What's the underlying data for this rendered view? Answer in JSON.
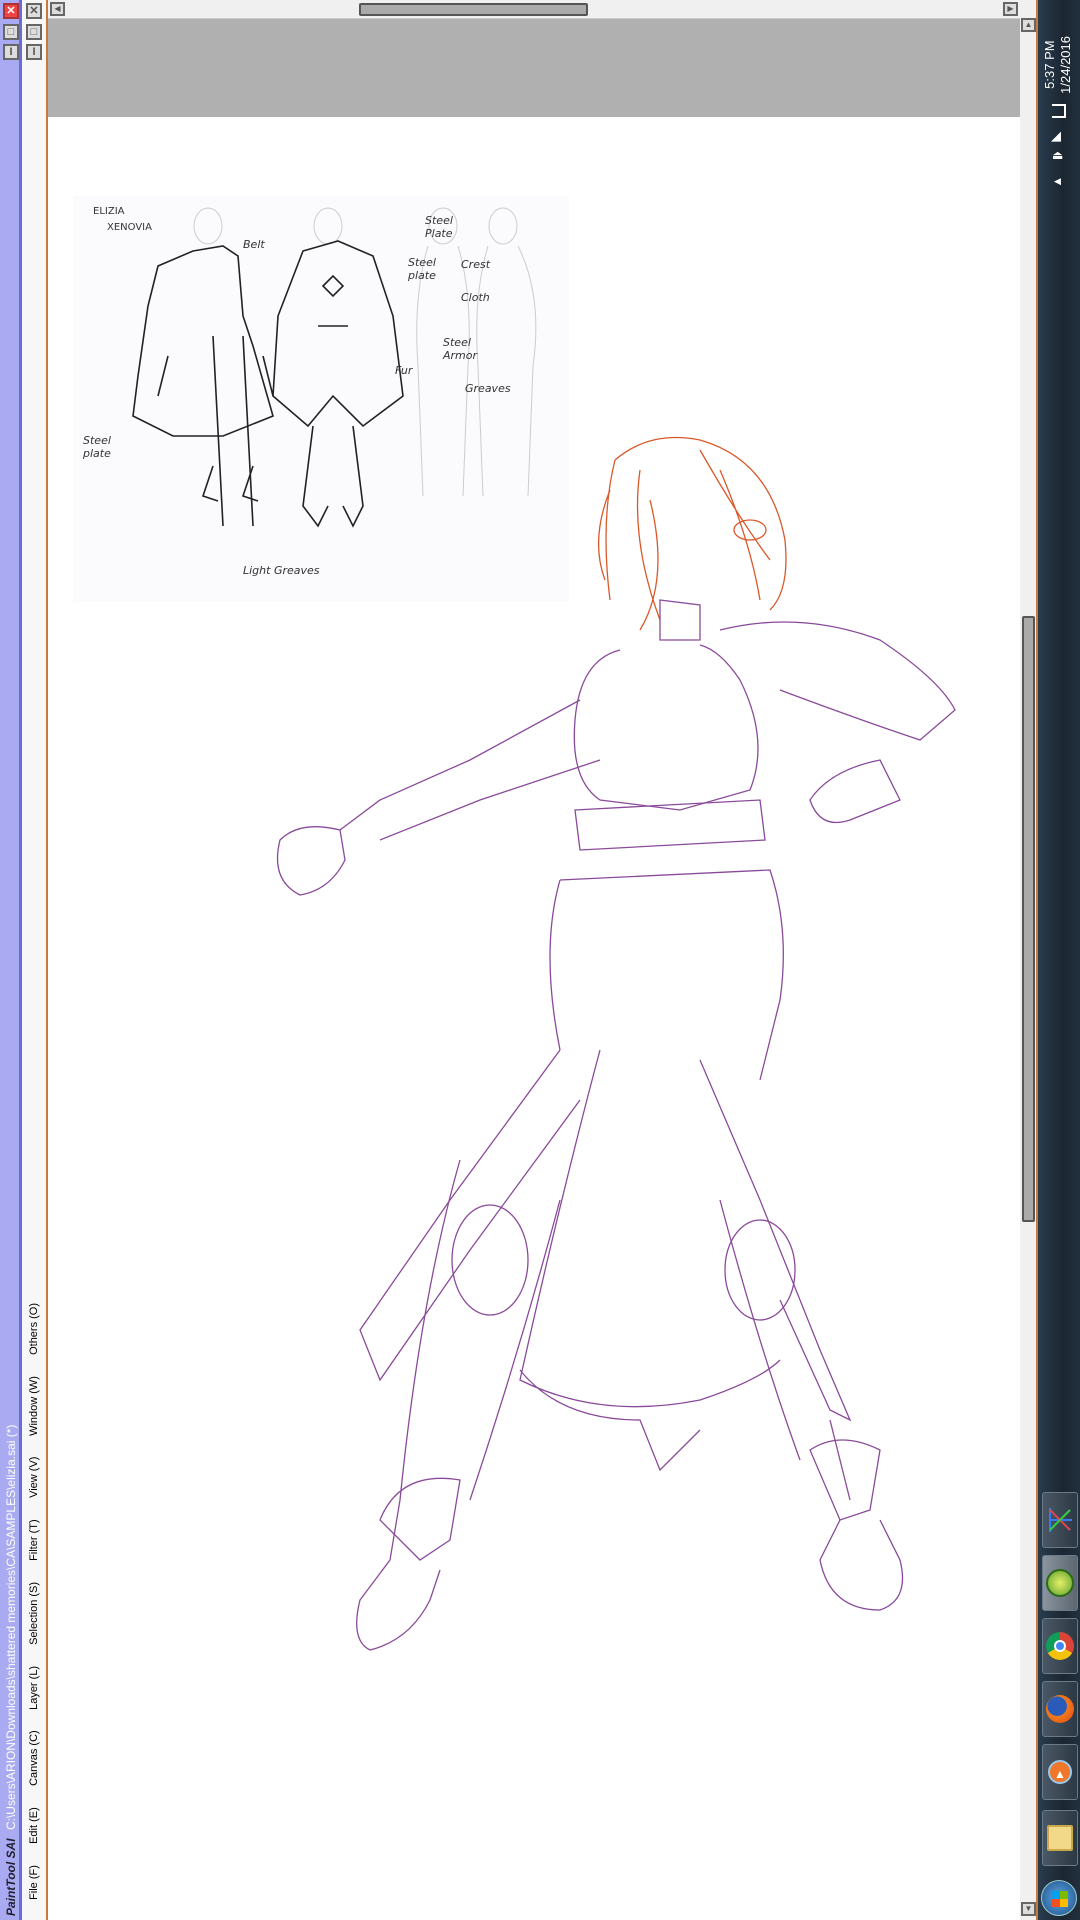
{
  "app": {
    "logo": "PaintTool SAI",
    "title": "C:\\Users\\ARION\\Downloads\\shattered memories\\CA\\SAMPLES\\elizia.sai (*)"
  },
  "menu": [
    "File (F)",
    "Edit (E)",
    "Canvas (C)",
    "Layer (L)",
    "Selection (S)",
    "Filter (T)",
    "View (V)",
    "Window (W)",
    "Others (O)"
  ],
  "sketch": {
    "name_line1": "ELIZIA",
    "name_line2": "XENOVIA",
    "labels": [
      "Belt",
      "Steel Plate",
      "Steel plate",
      "Crest",
      "Cloth",
      "Steel Armor",
      "Fur",
      "Greaves",
      "Steel plate",
      "Light Greaves"
    ]
  },
  "taskbar": {
    "time": "5:37 PM",
    "date": "1/24/2016",
    "tray_icons": [
      "network-icon",
      "volume-icon",
      "eject-icon",
      "show-hidden-icon"
    ],
    "apps": [
      "app-x-icon",
      "painttool-sai-icon",
      "chrome-icon",
      "firefox-icon",
      "uploader-icon",
      "file-explorer-icon",
      "start-button"
    ]
  },
  "colors": {
    "lineart": "#8a4a9a",
    "hair": "#d9582a",
    "titlebar": "#aaaaf2"
  }
}
